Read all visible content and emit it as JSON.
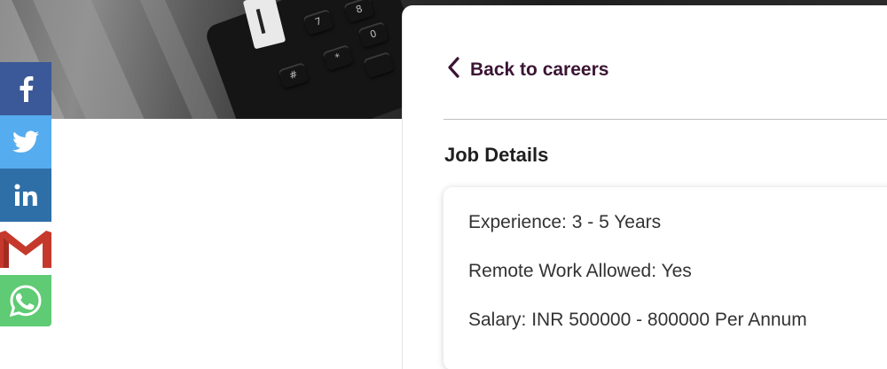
{
  "share": {
    "items": [
      {
        "name": "facebook",
        "icon": "facebook-icon",
        "color": "#3b5998"
      },
      {
        "name": "twitter",
        "icon": "twitter-icon",
        "color": "#55acee"
      },
      {
        "name": "linkedin",
        "icon": "linkedin-icon",
        "color": "#2f6fa7"
      },
      {
        "name": "gmail",
        "icon": "gmail-icon",
        "color": "#d44638"
      },
      {
        "name": "whatsapp",
        "icon": "whatsapp-icon",
        "color": "#5fcb74"
      }
    ]
  },
  "header": {
    "back_label": "Back to careers",
    "back_icon": "chevron-left-icon",
    "accent_color": "#3b1534"
  },
  "job_details": {
    "title": "Job Details",
    "experience": "Experience: 3 - 5 Years",
    "remote": "Remote Work Allowed: Yes",
    "salary": "Salary: INR 500000 - 800000 Per Annum"
  },
  "hero": {
    "keypad_keys": [
      "7",
      "8",
      "0",
      "*",
      "#"
    ]
  }
}
